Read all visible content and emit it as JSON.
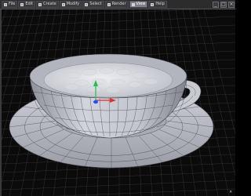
{
  "menubar": {
    "tabs": [
      {
        "label": "File",
        "active": false
      },
      {
        "label": "Edit",
        "active": false
      },
      {
        "label": "Create",
        "active": false
      },
      {
        "label": "Modify",
        "active": false
      },
      {
        "label": "Select",
        "active": false
      },
      {
        "label": "Render",
        "active": false
      },
      {
        "label": "View",
        "active": true
      },
      {
        "label": "Help",
        "active": false
      }
    ],
    "window_buttons": [
      "_",
      "□",
      "×"
    ]
  },
  "viewport": {
    "background": "#0b0b0c",
    "grid_color": "#6e6e72",
    "mesh_face_color": "#c9cbd3",
    "mesh_wire_color": "#4a4c57",
    "liquid_color": "#dcdde2",
    "gizmo": {
      "x_axis_color": "#e0322c",
      "y_axis_color": "#22c24a",
      "z_axis_color": "#2a4cff"
    },
    "corner_label": "✕"
  }
}
